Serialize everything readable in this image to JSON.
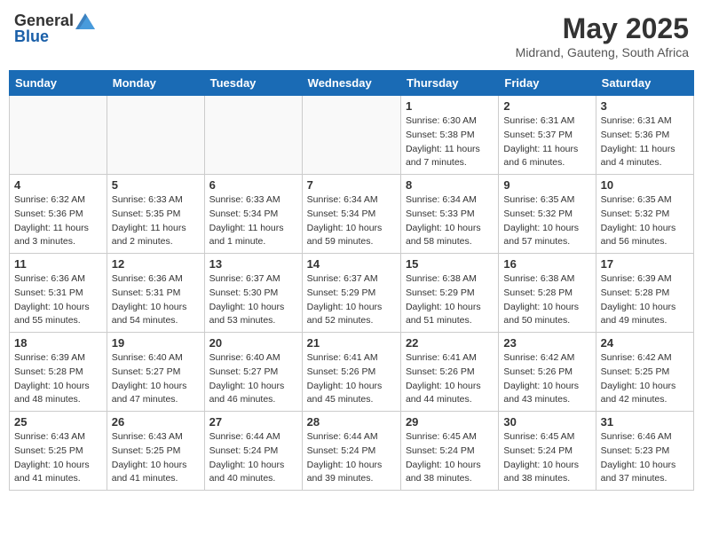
{
  "logo": {
    "general": "General",
    "blue": "Blue"
  },
  "header": {
    "month": "May 2025",
    "location": "Midrand, Gauteng, South Africa"
  },
  "weekdays": [
    "Sunday",
    "Monday",
    "Tuesday",
    "Wednesday",
    "Thursday",
    "Friday",
    "Saturday"
  ],
  "weeks": [
    [
      {
        "day": "",
        "info": ""
      },
      {
        "day": "",
        "info": ""
      },
      {
        "day": "",
        "info": ""
      },
      {
        "day": "",
        "info": ""
      },
      {
        "day": "1",
        "info": "Sunrise: 6:30 AM\nSunset: 5:38 PM\nDaylight: 11 hours\nand 7 minutes."
      },
      {
        "day": "2",
        "info": "Sunrise: 6:31 AM\nSunset: 5:37 PM\nDaylight: 11 hours\nand 6 minutes."
      },
      {
        "day": "3",
        "info": "Sunrise: 6:31 AM\nSunset: 5:36 PM\nDaylight: 11 hours\nand 4 minutes."
      }
    ],
    [
      {
        "day": "4",
        "info": "Sunrise: 6:32 AM\nSunset: 5:36 PM\nDaylight: 11 hours\nand 3 minutes."
      },
      {
        "day": "5",
        "info": "Sunrise: 6:33 AM\nSunset: 5:35 PM\nDaylight: 11 hours\nand 2 minutes."
      },
      {
        "day": "6",
        "info": "Sunrise: 6:33 AM\nSunset: 5:34 PM\nDaylight: 11 hours\nand 1 minute."
      },
      {
        "day": "7",
        "info": "Sunrise: 6:34 AM\nSunset: 5:34 PM\nDaylight: 10 hours\nand 59 minutes."
      },
      {
        "day": "8",
        "info": "Sunrise: 6:34 AM\nSunset: 5:33 PM\nDaylight: 10 hours\nand 58 minutes."
      },
      {
        "day": "9",
        "info": "Sunrise: 6:35 AM\nSunset: 5:32 PM\nDaylight: 10 hours\nand 57 minutes."
      },
      {
        "day": "10",
        "info": "Sunrise: 6:35 AM\nSunset: 5:32 PM\nDaylight: 10 hours\nand 56 minutes."
      }
    ],
    [
      {
        "day": "11",
        "info": "Sunrise: 6:36 AM\nSunset: 5:31 PM\nDaylight: 10 hours\nand 55 minutes."
      },
      {
        "day": "12",
        "info": "Sunrise: 6:36 AM\nSunset: 5:31 PM\nDaylight: 10 hours\nand 54 minutes."
      },
      {
        "day": "13",
        "info": "Sunrise: 6:37 AM\nSunset: 5:30 PM\nDaylight: 10 hours\nand 53 minutes."
      },
      {
        "day": "14",
        "info": "Sunrise: 6:37 AM\nSunset: 5:29 PM\nDaylight: 10 hours\nand 52 minutes."
      },
      {
        "day": "15",
        "info": "Sunrise: 6:38 AM\nSunset: 5:29 PM\nDaylight: 10 hours\nand 51 minutes."
      },
      {
        "day": "16",
        "info": "Sunrise: 6:38 AM\nSunset: 5:28 PM\nDaylight: 10 hours\nand 50 minutes."
      },
      {
        "day": "17",
        "info": "Sunrise: 6:39 AM\nSunset: 5:28 PM\nDaylight: 10 hours\nand 49 minutes."
      }
    ],
    [
      {
        "day": "18",
        "info": "Sunrise: 6:39 AM\nSunset: 5:28 PM\nDaylight: 10 hours\nand 48 minutes."
      },
      {
        "day": "19",
        "info": "Sunrise: 6:40 AM\nSunset: 5:27 PM\nDaylight: 10 hours\nand 47 minutes."
      },
      {
        "day": "20",
        "info": "Sunrise: 6:40 AM\nSunset: 5:27 PM\nDaylight: 10 hours\nand 46 minutes."
      },
      {
        "day": "21",
        "info": "Sunrise: 6:41 AM\nSunset: 5:26 PM\nDaylight: 10 hours\nand 45 minutes."
      },
      {
        "day": "22",
        "info": "Sunrise: 6:41 AM\nSunset: 5:26 PM\nDaylight: 10 hours\nand 44 minutes."
      },
      {
        "day": "23",
        "info": "Sunrise: 6:42 AM\nSunset: 5:26 PM\nDaylight: 10 hours\nand 43 minutes."
      },
      {
        "day": "24",
        "info": "Sunrise: 6:42 AM\nSunset: 5:25 PM\nDaylight: 10 hours\nand 42 minutes."
      }
    ],
    [
      {
        "day": "25",
        "info": "Sunrise: 6:43 AM\nSunset: 5:25 PM\nDaylight: 10 hours\nand 41 minutes."
      },
      {
        "day": "26",
        "info": "Sunrise: 6:43 AM\nSunset: 5:25 PM\nDaylight: 10 hours\nand 41 minutes."
      },
      {
        "day": "27",
        "info": "Sunrise: 6:44 AM\nSunset: 5:24 PM\nDaylight: 10 hours\nand 40 minutes."
      },
      {
        "day": "28",
        "info": "Sunrise: 6:44 AM\nSunset: 5:24 PM\nDaylight: 10 hours\nand 39 minutes."
      },
      {
        "day": "29",
        "info": "Sunrise: 6:45 AM\nSunset: 5:24 PM\nDaylight: 10 hours\nand 38 minutes."
      },
      {
        "day": "30",
        "info": "Sunrise: 6:45 AM\nSunset: 5:24 PM\nDaylight: 10 hours\nand 38 minutes."
      },
      {
        "day": "31",
        "info": "Sunrise: 6:46 AM\nSunset: 5:23 PM\nDaylight: 10 hours\nand 37 minutes."
      }
    ]
  ]
}
